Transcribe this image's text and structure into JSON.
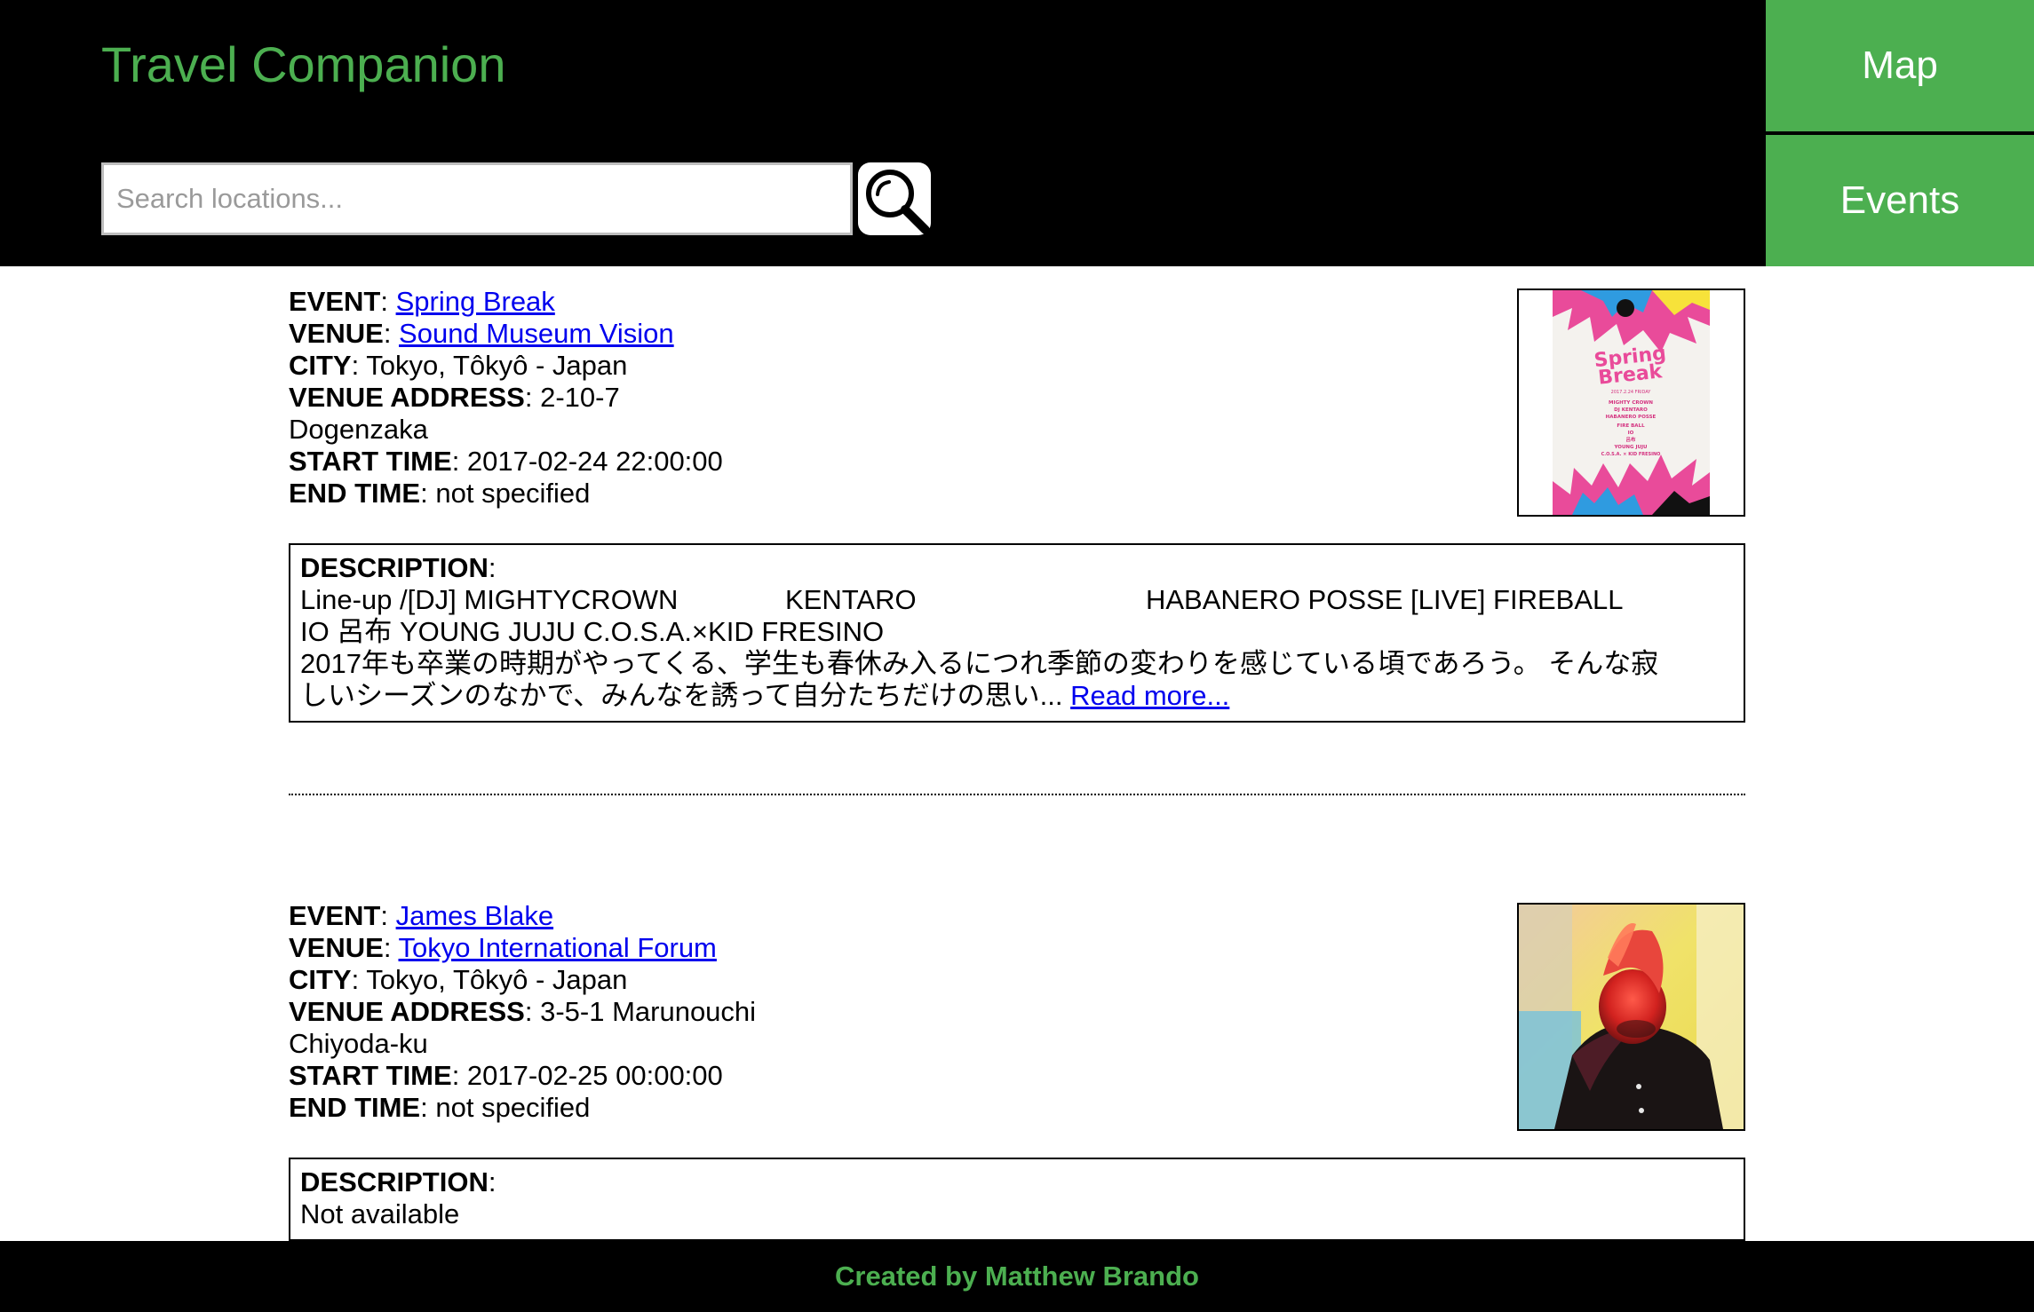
{
  "header": {
    "title": "Travel Companion",
    "search_placeholder": "Search locations...",
    "search_icon": "magnifier-icon"
  },
  "nav": {
    "map_label": "Map",
    "events_label": "Events"
  },
  "labels": {
    "event": "EVENT",
    "venue": "VENUE",
    "city": "CITY",
    "venue_address": "VENUE ADDRESS",
    "start_time": "START TIME",
    "end_time": "END TIME",
    "description": "DESCRIPTION"
  },
  "events": [
    {
      "name": "Spring Break",
      "venue": "Sound Museum Vision",
      "city": "Tokyo, Tôkyô - Japan",
      "address_line1": "2-10-7",
      "address_line2": "Dogenzaka",
      "start_time": "2017-02-24 22:00:00",
      "end_time": "not specified",
      "description_lineup": "Line-up /[DJ] MIGHTYCROWN              KENTARO                              HABANERO POSSE [LIVE] FIREBALL",
      "description_line2": "IO 呂布 YOUNG JUJU C.O.S.A.×KID FRESINO",
      "description_line3": "2017年も卒業の時期がやってくる、学生も春休み入るにつれ季節の変わりを感じている頃であろう。 そんな寂",
      "description_line4": "しいシーズンのなかで、みんなを誘って自分たちだけの思い... ",
      "read_more": "Read more...",
      "poster": {
        "title_line1": "Spring",
        "title_line2": "Break",
        "date": "2017.2.24 FRIDAY",
        "lines": [
          "MIGHTY CROWN",
          "DJ KENTARO",
          "HABANERO POSSE",
          "FIRE BALL",
          "IO",
          "呂布",
          "YOUNG JUJU",
          "C.O.S.A. × KID FRESINO"
        ]
      }
    },
    {
      "name": "James Blake",
      "venue": "Tokyo International Forum",
      "city": "Tokyo, Tôkyô - Japan",
      "address_line1": "3-5-1 Marunouchi",
      "address_line2": "Chiyoda-ku",
      "start_time": "2017-02-25 00:00:00",
      "end_time": "not specified",
      "description_text": "Not available"
    }
  ],
  "footer": {
    "credit": "Created by Matthew Brando"
  },
  "colors": {
    "accent": "#4caf50",
    "header_bg": "#000000",
    "link": "#0000ee"
  }
}
